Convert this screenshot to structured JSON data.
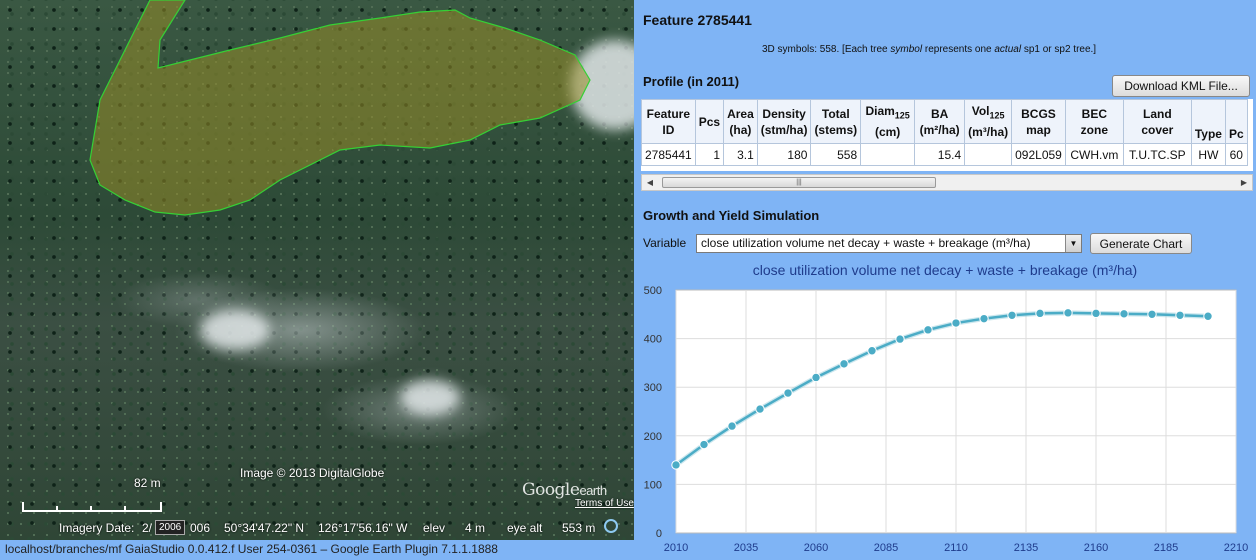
{
  "map": {
    "scale_label": "82 m",
    "image_credit": "Image © 2013 DigitalGlobe",
    "logo_text": "Google",
    "logo_text_small": "earth",
    "terms_link": "Terms of Use",
    "imagery_date_label": "Imagery Date:",
    "imagery_date_value": "2/",
    "timeline_badge": "2006",
    "imagery_date_suffix": "006",
    "latitude": "50°34'47.22\" N",
    "longitude": "126°17'56.16\" W",
    "elev_label": "elev",
    "elev_value": "4 m",
    "eye_alt_label": "eye alt",
    "eye_alt_value": "553 m"
  },
  "footer": {
    "text": "localhost/branches/mf  GaiaStudio 0.0.412.f  User 254-0361  –  Google Earth Plugin 7.1.1.1888"
  },
  "panel": {
    "feature_title": "Feature 2785441",
    "symbols_note_1": "3D symbols: 558.   [Each tree ",
    "symbols_note_2": "symbol",
    "symbols_note_3": " represents one ",
    "symbols_note_4": "actual",
    "symbols_note_5": " sp1 or sp2 tree.]",
    "profile_title": "Profile (in 2011)",
    "download_button": "Download KML File...",
    "table": {
      "headers": {
        "feature_id_1": "Feature",
        "feature_id_2": "ID",
        "pcs": "Pcs",
        "area_1": "Area",
        "area_2": "(ha)",
        "density_1": "Density",
        "density_2": "(stm/ha)",
        "total_1": "Total",
        "total_2": "(stems)",
        "diam_1": "Diam",
        "diam_sub": "125",
        "diam_2": "(cm)",
        "ba_1": "BA",
        "ba_2": "(m²/ha)",
        "vol_1": "Vol",
        "vol_sub": "125",
        "vol_2": "(m³/ha)",
        "bcgs_1": "BCGS",
        "bcgs_2": "map",
        "bec_1": "BEC",
        "bec_2": "zone",
        "land_1": "Land",
        "land_2": "cover",
        "type": "Type",
        "pc": "Pc"
      },
      "row": {
        "feature_id": "2785441",
        "pcs": "1",
        "area": "3.1",
        "density": "180",
        "total": "558",
        "diam": "",
        "ba": "15.4",
        "vol": "",
        "bcgs": "092L059",
        "bec": "CWH.vm",
        "land": "T.U.TC.SP",
        "type": "HW",
        "pc": "60"
      }
    },
    "growth_title": "Growth and Yield Simulation",
    "variable_label": "Variable",
    "variable_value": "close utilization volume net decay + waste + breakage (m³/ha)",
    "generate_button": "Generate Chart"
  },
  "chart_data": {
    "type": "line",
    "title": "close utilization volume net decay + waste + breakage (m³/ha)",
    "xlabel": "",
    "ylabel": "",
    "xlim": [
      2010,
      2210
    ],
    "ylim": [
      0,
      500
    ],
    "x_ticks": [
      2010,
      2035,
      2060,
      2085,
      2110,
      2135,
      2160,
      2185,
      2210
    ],
    "y_ticks": [
      0,
      100,
      200,
      300,
      400,
      500
    ],
    "grid": true,
    "legend": "none",
    "color": "#4bacc6",
    "series": [
      {
        "x": [
          2010,
          2020,
          2030,
          2040,
          2050,
          2060,
          2070,
          2080,
          2090,
          2100,
          2110,
          2120,
          2130,
          2140,
          2150,
          2160,
          2170,
          2180,
          2190,
          2200
        ],
        "values": [
          140,
          182,
          220,
          255,
          288,
          320,
          348,
          375,
          399,
          418,
          432,
          441,
          448,
          452,
          453,
          452,
          451,
          450,
          448,
          446
        ]
      }
    ]
  }
}
